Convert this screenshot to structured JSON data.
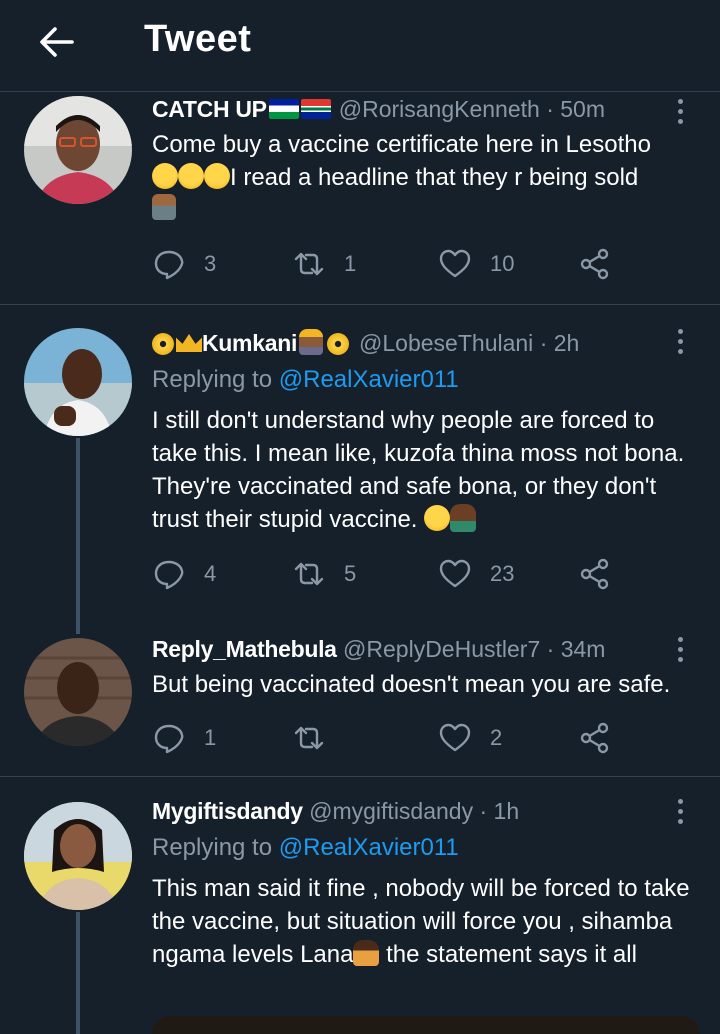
{
  "header": {
    "title": "Tweet"
  },
  "tweets": [
    {
      "name": "CATCH UP",
      "handle": "@RorisangKenneth",
      "time": "· 50m",
      "reply_to_label": "",
      "reply_to_mention": "",
      "text_line1": "Come buy a vaccine certificate here in Lesotho",
      "text_line2": "I read a headline that they r being sold",
      "replies": "3",
      "retweets": "1",
      "likes": "10"
    },
    {
      "name": "Kumkani",
      "handle": "@LobeseThulani",
      "time": "· 2h",
      "reply_to_label": "Replying to",
      "reply_to_mention": "@RealXavier011",
      "text": "I still don't understand why people are forced to take this. I mean like, kuzofa thina moss not bona. They're vaccinated and safe bona, or they don't trust their stupid vaccine.",
      "replies": "4",
      "retweets": "5",
      "likes": "23"
    },
    {
      "name": "Reply_Mathebula",
      "handle": "@ReplyDeHustler7",
      "time": "· 34m",
      "text": "But being vaccinated doesn't mean you are safe.",
      "replies": "1",
      "retweets": "",
      "likes": "2"
    },
    {
      "name": "Mygiftisdandy",
      "handle": "@mygiftisdandy",
      "time": "· 1h",
      "reply_to_label": "Replying to",
      "reply_to_mention": "@RealXavier011",
      "text_a": "This man said it fine , nobody will be forced to take the vaccine, but situation will force you , sihamba ngama levels Lana",
      "text_b": " the statement says it all"
    }
  ],
  "colors": {
    "background": "#15202b",
    "accent": "#1d9bf0",
    "muted": "#8b98a5",
    "divider": "#38444d"
  },
  "icons": [
    "back-arrow-icon",
    "reply-icon",
    "retweet-icon",
    "like-icon",
    "share-icon",
    "more-icon"
  ]
}
